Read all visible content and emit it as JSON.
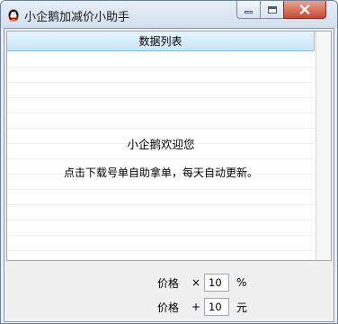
{
  "window": {
    "title": "小企鹅加减价小助手"
  },
  "list": {
    "header": "数据列表",
    "welcome_line1": "小企鹅欢迎您",
    "welcome_line2": "点击下载号单自助拿单，每天自动更新。"
  },
  "controls": {
    "multiply": {
      "label": "价格",
      "operator": "×",
      "value": "10",
      "unit": "%"
    },
    "add": {
      "label": "价格",
      "operator": "+",
      "value": "10",
      "unit": "元"
    }
  }
}
